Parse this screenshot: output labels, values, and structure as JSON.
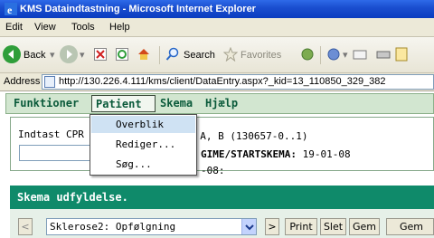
{
  "window": {
    "title": "KMS Dataindtastning - Microsoft Internet Explorer"
  },
  "browser_menu": [
    "Edit",
    "View",
    "Tools",
    "Help"
  ],
  "toolbar": {
    "back_label": "Back",
    "search_label": "Search",
    "favorites_label": "Favorites"
  },
  "address": {
    "label": "Address",
    "url": "http://130.226.4.111/kms/client/DataEntry.aspx?_kid=13_110850_329_382"
  },
  "app_menu": {
    "functions": "Funktioner",
    "patient": "Patient",
    "skema": "Skema",
    "help": "Hjælp"
  },
  "patient_dropdown": {
    "items": [
      "Overblik",
      "Rediger...",
      "Søg..."
    ],
    "active_index": 0
  },
  "cpr": {
    "label_partial": "Indtast CPR n",
    "input_value": ""
  },
  "patient_info": {
    "name_fragment": ": A, B (130657-0..1)",
    "regime_label": "GIME/STARTSKEMA:",
    "regime_value": "19-01-08",
    "date_fragment": "-08:"
  },
  "skema": {
    "header": "Skema udfyldelse.",
    "prev_label": "<",
    "next_label": ">",
    "selected": "Sklerose2: Opfølgning",
    "print_label": "Print",
    "delete_label": "Slet",
    "save_label": "Gem",
    "save2_label": "Gem"
  },
  "colors": {
    "app_menu_bg": "#d2e6d0",
    "skema_header_bg": "#0f8a6a",
    "menu_text": "#0a5a3a"
  }
}
